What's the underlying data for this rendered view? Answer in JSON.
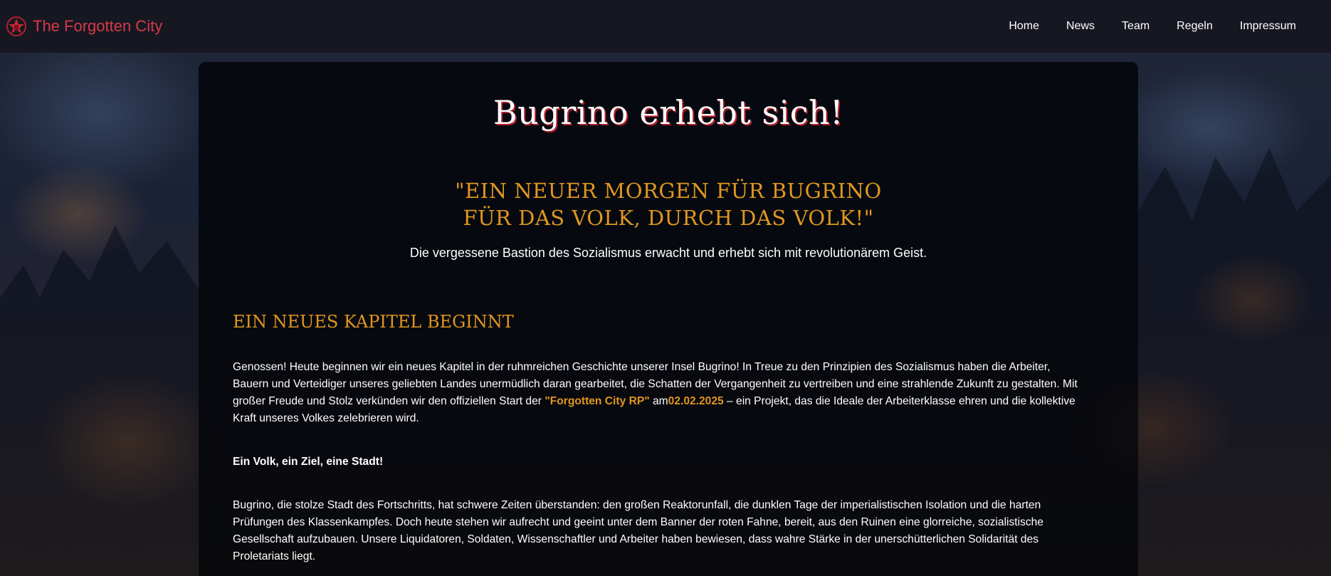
{
  "nav": {
    "brand": "The Forgotten City",
    "links": [
      "Home",
      "News",
      "Team",
      "Regeln",
      "Impressum"
    ]
  },
  "hero": {
    "headline": "Bugrino erhebt sich!",
    "slogan_line1": "\"EIN NEUER MORGEN FÜR BUGRINO",
    "slogan_line2": "FÜR DAS VOLK, DURCH DAS VOLK!\"",
    "tagline": "Die vergessene Bastion des Sozialismus erwacht und erhebt sich mit revolutionärem Geist."
  },
  "section": {
    "title": "EIN NEUES KAPITEL BEGINNT",
    "para1_start": "Genossen! Heute beginnen wir ein neues Kapitel in der ruhmreichen Geschichte unserer Insel Bugrino! In Treue zu den Prinzipien des Sozialismus haben die Arbeiter, Bauern und Verteidiger unseres geliebten Landes unermüdlich daran gearbeitet, die Schatten der Vergangenheit zu vertreiben und eine strahlende Zukunft zu gestalten. Mit großer Freude und Stolz verkünden wir den offiziellen Start der ",
    "project_name": "\"Forgotten City RP\"",
    "para1_mid": " am",
    "launch_date": "02.02.2025",
    "para1_end": " – ein Projekt, das die Ideale der Arbeiterklasse ehren und die kollektive Kraft unseres Volkes zelebrieren wird.",
    "motto": "Ein Volk, ein Ziel, eine Stadt!",
    "para2": "Bugrino, die stolze Stadt des Fortschritts, hat schwere Zeiten überstanden: den großen Reaktorunfall, die dunklen Tage der imperialistischen Isolation und die harten Prüfungen des Klassenkampfes. Doch heute stehen wir aufrecht und geeint unter dem Banner der roten Fahne, bereit, aus den Ruinen eine glorreiche, sozialistische Gesellschaft aufzubauen. Unsere Liquidatoren, Soldaten, Wissenschaftler und Arbeiter haben bewiesen, dass wahre Stärke in der unerschütterlichen Solidarität des Proletariats liegt."
  },
  "icons": {
    "brand_logo": "red-star-emblem-icon"
  },
  "colors": {
    "brand_red": "#d63a4a",
    "accent_gold": "#e0971f",
    "panel_bg": "#03060a"
  }
}
